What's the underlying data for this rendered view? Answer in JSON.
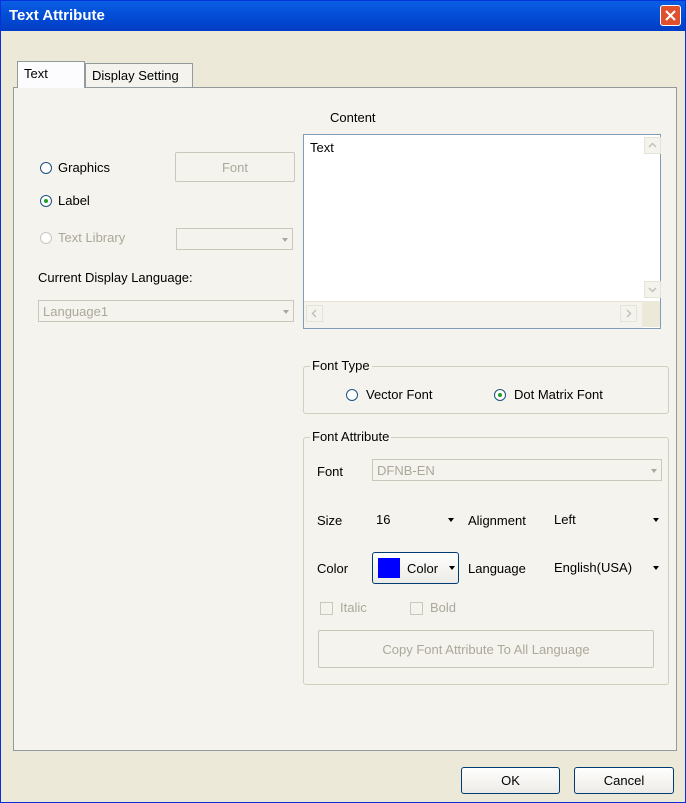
{
  "window": {
    "title": "Text Attribute"
  },
  "tabs": [
    {
      "label": "Text"
    },
    {
      "label": "Display Setting"
    }
  ],
  "content_label": "Content",
  "content_text": "Text",
  "options": {
    "graphics": "Graphics",
    "label": "Label",
    "text_library": "Text Library",
    "font_button": "Font",
    "current_language_label": "Current Display Language:",
    "current_language_value": "Language1"
  },
  "font_type": {
    "legend": "Font Type",
    "vector": "Vector Font",
    "dot_matrix": "Dot Matrix Font",
    "selected": "Dot Matrix Font"
  },
  "font_attribute": {
    "legend": "Font Attribute",
    "font_label": "Font",
    "font_value": "DFNB-EN",
    "size_label": "Size",
    "size_value": "16",
    "alignment_label": "Alignment",
    "alignment_value": "Left",
    "color_label": "Color",
    "color_button": "Color",
    "color_value": "#0000ff",
    "language_label": "Language",
    "language_value": "English(USA)",
    "italic": "Italic",
    "bold": "Bold",
    "copy_button": "Copy Font Attribute To All Language"
  },
  "footer": {
    "ok": "OK",
    "cancel": "Cancel"
  }
}
